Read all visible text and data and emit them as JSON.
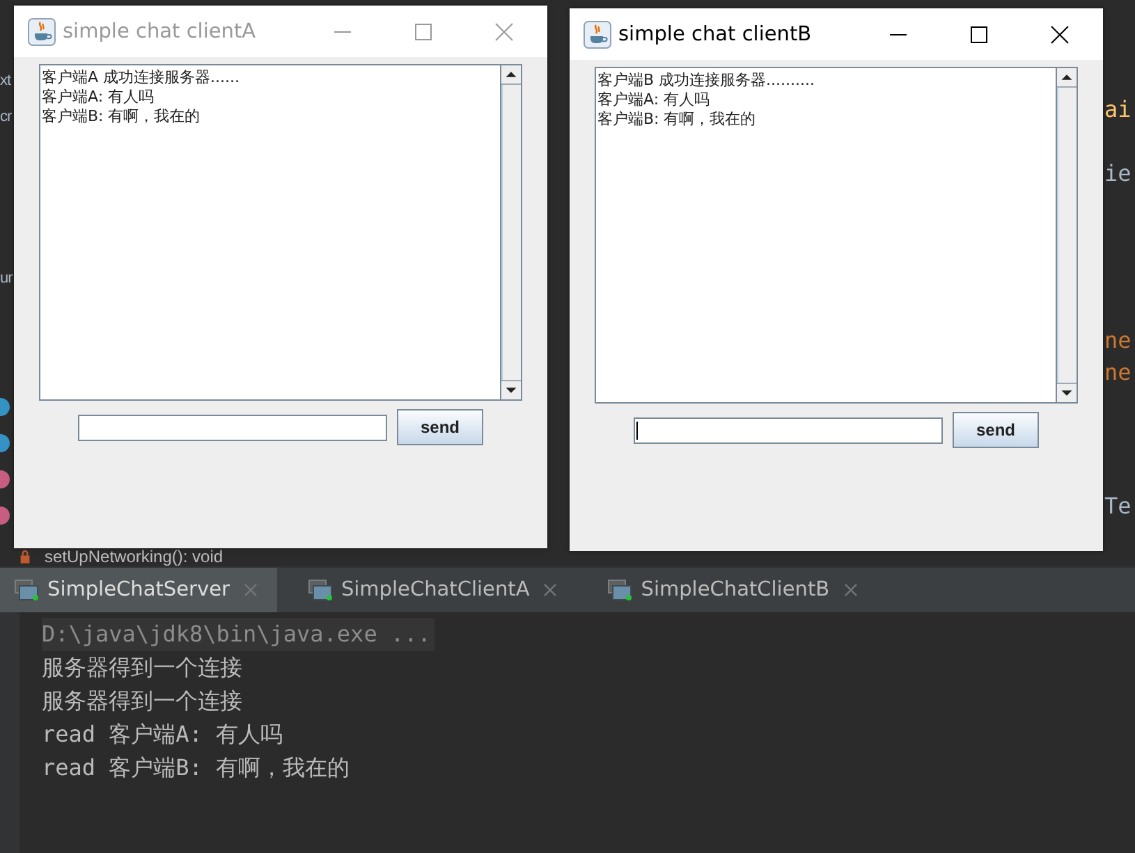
{
  "editor_fragments": {
    "left": [
      "xt",
      "cr",
      "ur"
    ],
    "right": [
      {
        "text": "ai",
        "kind": "method"
      },
      {
        "text": "ie",
        "kind": "plain"
      },
      {
        "text": "ne",
        "kind": "keyword"
      },
      {
        "text": "ne",
        "kind": "keyword"
      },
      {
        "text": "Te",
        "kind": "plain"
      }
    ],
    "structure_item": "setUpNetworking(): void"
  },
  "windows": [
    {
      "title": "simple chat clientA",
      "active": false,
      "messages": [
        "客户端A 成功连接服务器......",
        "客户端A: 有人吗",
        "客户端B: 有啊，我在的"
      ],
      "button": "send"
    },
    {
      "title": "simple chat clientB",
      "active": true,
      "messages": [
        "客户端B 成功连接服务器..........",
        "客户端A: 有人吗",
        "客户端B: 有啊，我在的"
      ],
      "button": "send"
    }
  ],
  "run_tabs": [
    {
      "label": "SimpleChatServer",
      "selected": true
    },
    {
      "label": "SimpleChatClientA",
      "selected": false
    },
    {
      "label": "SimpleChatClientB",
      "selected": false
    }
  ],
  "console_lines": [
    {
      "text": "D:\\java\\jdk8\\bin\\java.exe ...",
      "kind": "command"
    },
    {
      "text": "服务器得到一个连接",
      "kind": "output"
    },
    {
      "text": "服务器得到一个连接",
      "kind": "output"
    },
    {
      "text": "read 客户端A: 有人吗",
      "kind": "output"
    },
    {
      "text": "read 客户端B: 有啊，我在的",
      "kind": "output"
    }
  ]
}
